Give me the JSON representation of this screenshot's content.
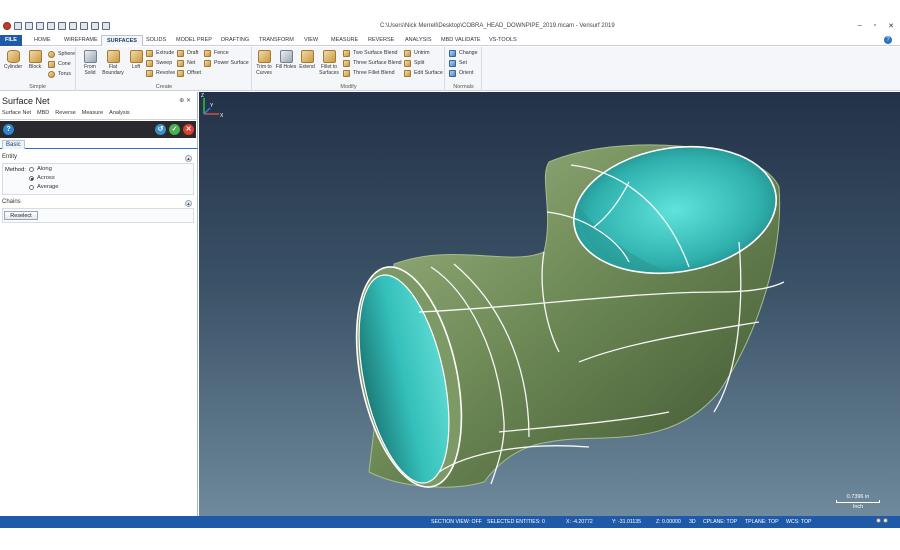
{
  "window": {
    "title": "C:\\Users\\Nick Merrell\\Desktop\\COBRA_HEAD_DOWNPIPE_2019.mcam - Verisurf 2019",
    "controls": [
      "–",
      "▫",
      "✕"
    ]
  },
  "menu_tabs": [
    "FILE",
    "HOME",
    "WIREFRAME",
    "SURFACES",
    "SOLIDS",
    "MODEL PREP",
    "DRAFTING",
    "TRANSFORM",
    "VIEW",
    "MEASURE",
    "REVERSE",
    "ANALYSIS",
    "MBD VALIDATE",
    "VS-TOOLS"
  ],
  "ribbon": {
    "simple": {
      "label": "Simple",
      "cylinder": "Cylinder",
      "block": "Block",
      "sphere": "Sphere",
      "cone": "Cone",
      "torus": "Torus"
    },
    "create": {
      "label": "Create",
      "from_solid": "From Solid",
      "flat_boundary": "Flat Boundary",
      "loft": "Loft",
      "extrude": "Extrude",
      "sweep": "Sweep",
      "revolve": "Revolve",
      "draft": "Draft",
      "net": "Net",
      "offset": "Offset",
      "fence": "Fence",
      "power_surface": "Power Surface"
    },
    "modify": {
      "label": "Modify",
      "trim_to_curves": "Trim to Curves",
      "fill_holes": "Fill Holes",
      "extend": "Extend",
      "fillet_to_surfaces": "Fillet to Surfaces",
      "two_surface_blend": "Two Surface Blend",
      "three_surface_blend": "Three Surface Blend",
      "three_fillet_blend": "Three Fillet Blend",
      "untrim": "Untrim",
      "split": "Split",
      "edit_surface": "Edit Surface"
    },
    "normals": {
      "label": "Normals",
      "change": "Change",
      "set": "Set",
      "orient": "Orient"
    }
  },
  "panel": {
    "title": "Surface Net",
    "pin": "⊕ ✕",
    "tabs": [
      "Surface Net",
      "MBD",
      "Reverse",
      "Measure",
      "Analysis"
    ],
    "basic_tab": "Basic",
    "entity": {
      "header": "Entity",
      "method_label": "Method:",
      "options": [
        "Along",
        "Across",
        "Average"
      ],
      "selected": "Across"
    },
    "chains": {
      "header": "Chains",
      "reselect": "Reselect"
    }
  },
  "viewport": {
    "scale_value": "0.7396 in",
    "scale_unit": "Inch"
  },
  "status": {
    "section_view": "SECTION VIEW: OFF",
    "selected": "SELECTED ENTITIES: 0",
    "x": "X:   -4.20772",
    "y": "Y:   -31.01135",
    "z": "Z:   0.00000",
    "mode": "3D",
    "cplane": "CPLANE: TOP",
    "tplane": "TPLANE: TOP",
    "wcs": "WCS: TOP"
  },
  "colors": {
    "accent": "#1e5aa8",
    "surface_green": "#6f8b57",
    "surface_teal": "#2fb0ad"
  }
}
